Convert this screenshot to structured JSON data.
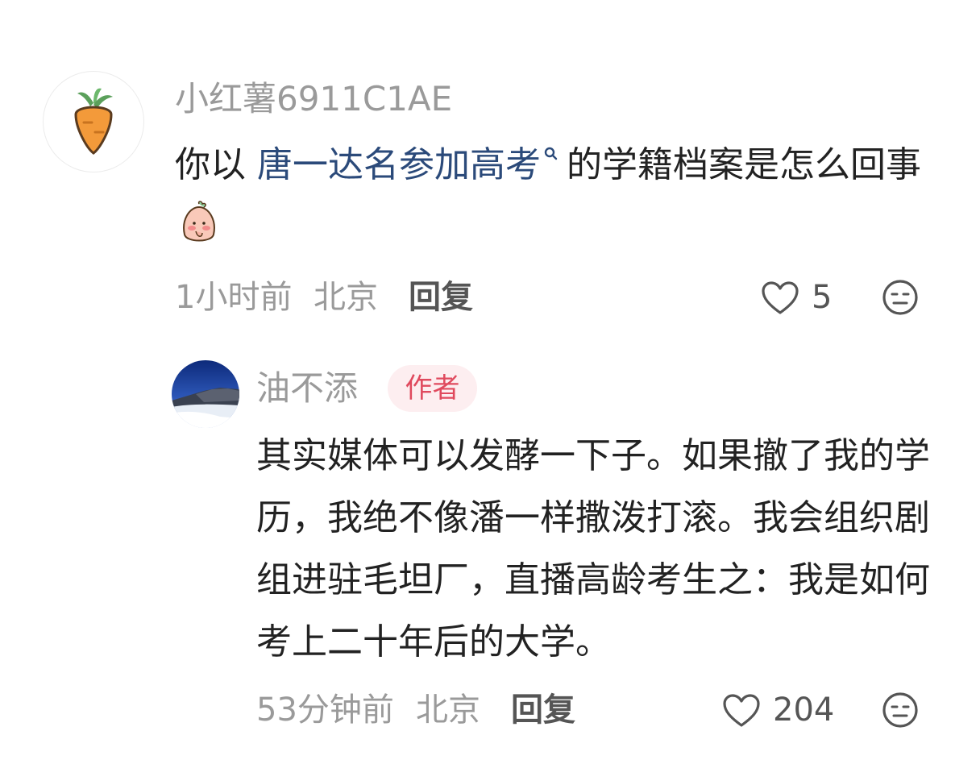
{
  "comment": {
    "username": "小红薯6911C1AE",
    "avatar_icon": "carrot-icon",
    "text_before_mention": "你以 ",
    "mention": "唐一达名参加高考",
    "mention_icon": "search-icon",
    "text_after_mention": "的学籍档案是怎么回事",
    "sticker_icon": "shy-face-sticker-icon",
    "time": "1小时前",
    "location": "北京",
    "reply_label": "回复",
    "like_icon": "heart-outline-icon",
    "like_count": "5",
    "dislike_icon": "meh-face-icon"
  },
  "reply": {
    "username": "油不添",
    "avatar_icon": "landscape-avatar",
    "badge": "作者",
    "text": "其实媒体可以发酵一下子。如果撤了我的学历，我绝不像潘一样撒泼打滚。我会组织剧组进驻毛坦厂，直播高龄考生之：我是如何考上二十年后的大学。",
    "time": "53分钟前",
    "location": "北京",
    "reply_label": "回复",
    "like_icon": "heart-outline-icon",
    "like_count": "204",
    "dislike_icon": "meh-face-icon"
  },
  "colors": {
    "meta_gray": "#9a9a9a",
    "text_dark": "#222222",
    "mention_blue": "#2b4a7a",
    "badge_bg": "#fdeef0",
    "badge_text": "#e04a5e",
    "icon_gray": "#555555"
  }
}
